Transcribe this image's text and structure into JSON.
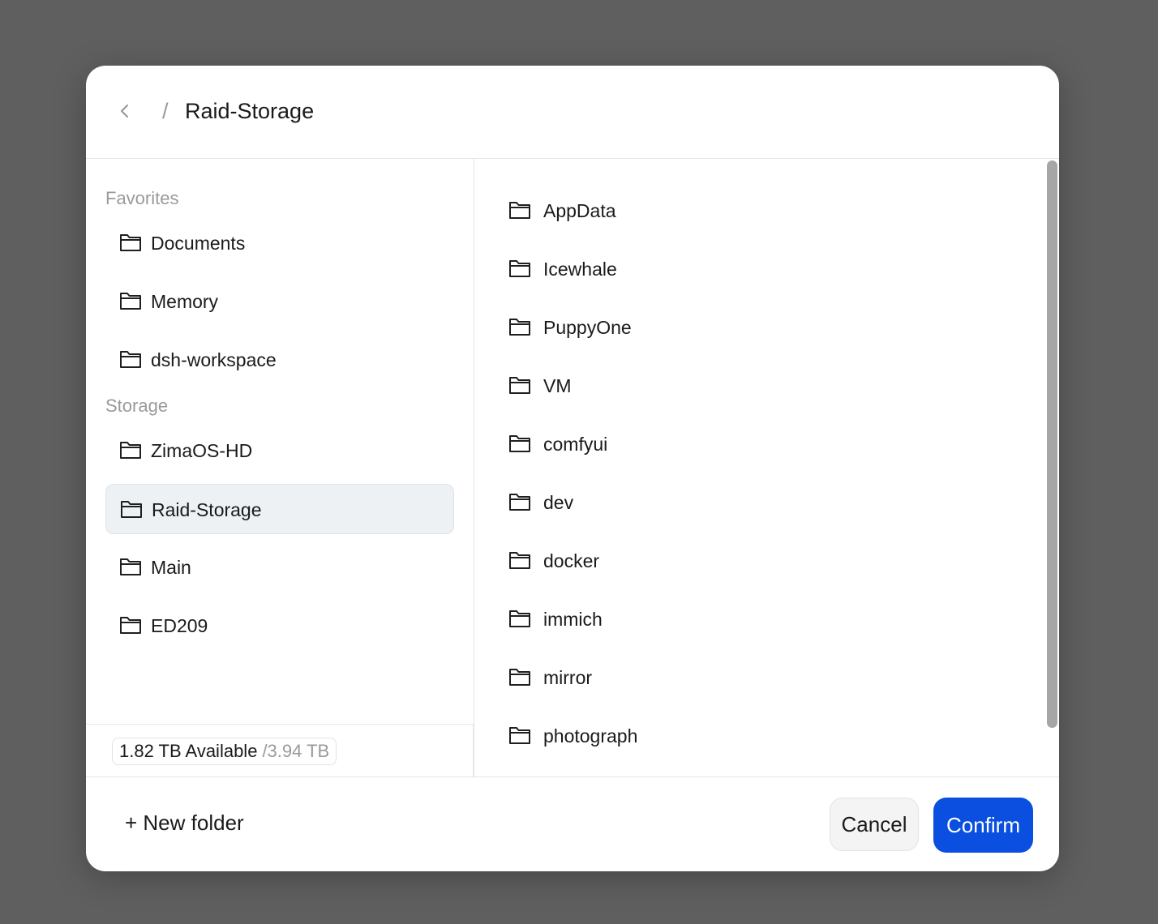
{
  "header": {
    "back_icon": "chevron-left-icon",
    "separator": "/",
    "current": "Raid-Storage"
  },
  "sidebar": {
    "favorites_label": "Favorites",
    "favorites": [
      {
        "label": "Documents",
        "icon": "folder-icon"
      },
      {
        "label": "Memory",
        "icon": "folder-icon"
      },
      {
        "label": "dsh-workspace",
        "icon": "folder-icon"
      }
    ],
    "storage_label": "Storage",
    "storage": [
      {
        "label": "ZimaOS-HD",
        "icon": "folder-icon",
        "selected": false
      },
      {
        "label": "Raid-Storage",
        "icon": "folder-icon",
        "selected": true
      },
      {
        "label": "Main",
        "icon": "folder-icon",
        "selected": false
      },
      {
        "label": "ED209",
        "icon": "folder-icon",
        "selected": false
      }
    ],
    "capacity": {
      "available": "1.82 TB Available",
      "total": "/3.94 TB"
    }
  },
  "main": {
    "folders": [
      {
        "label": "AppData",
        "icon": "folder-icon"
      },
      {
        "label": "Icewhale",
        "icon": "folder-icon"
      },
      {
        "label": "PuppyOne",
        "icon": "folder-icon"
      },
      {
        "label": "VM",
        "icon": "folder-icon"
      },
      {
        "label": "comfyui",
        "icon": "folder-icon"
      },
      {
        "label": "dev",
        "icon": "folder-icon"
      },
      {
        "label": "docker",
        "icon": "folder-icon"
      },
      {
        "label": "immich",
        "icon": "folder-icon"
      },
      {
        "label": "mirror",
        "icon": "folder-icon"
      },
      {
        "label": "photograph",
        "icon": "folder-icon"
      }
    ]
  },
  "footer": {
    "new_folder": "+ New folder",
    "cancel": "Cancel",
    "confirm": "Confirm"
  },
  "colors": {
    "backdrop": "#5f5f5f",
    "accent": "#0a4fe0",
    "selected_bg": "#eef1f4",
    "muted_text": "#9a9a9a"
  }
}
